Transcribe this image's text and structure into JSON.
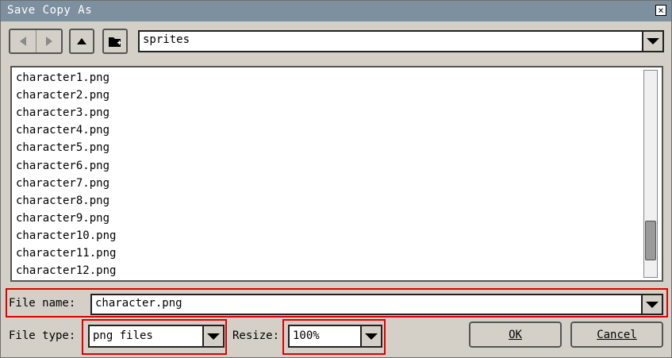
{
  "window": {
    "title": "Save Copy As"
  },
  "toolbar": {
    "back_icon": "arrow-left-icon",
    "forward_icon": "arrow-right-icon",
    "up_icon": "arrow-up-icon",
    "new_folder_icon": "new-folder-icon",
    "location_value": "sprites"
  },
  "file_list": {
    "items": [
      "character1.png",
      "character2.png",
      "character3.png",
      "character4.png",
      "character5.png",
      "character6.png",
      "character7.png",
      "character8.png",
      "character9.png",
      "character10.png",
      "character11.png",
      "character12.png"
    ],
    "scroll_position_fraction": 0.9
  },
  "file_name": {
    "label": "File name:",
    "value": "character.png"
  },
  "file_type": {
    "label": "File type:",
    "value": "png files"
  },
  "resize": {
    "label": "Resize:",
    "value": "100%"
  },
  "buttons": {
    "ok": "OK",
    "cancel": "Cancel"
  },
  "colors": {
    "titlebar": "#7d90a0",
    "highlight": "#e00000",
    "face": "#d4d0c8"
  }
}
